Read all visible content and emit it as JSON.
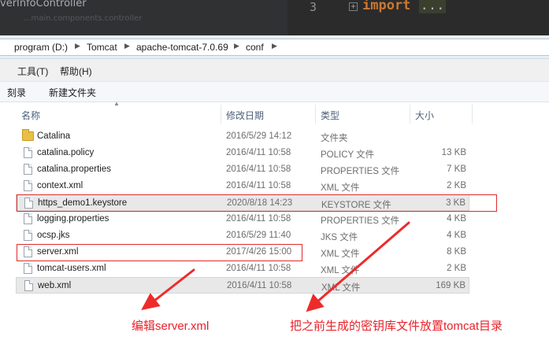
{
  "ide": {
    "class_name": "verInfoController",
    "class_name_ghost": "...main.components.controller",
    "line_number": "3",
    "fold_icon": "plus",
    "code_keyword": "import",
    "code_rest": "..."
  },
  "breadcrumbs": [
    "program (D:)",
    "Tomcat",
    "apache-tomcat-7.0.69",
    "conf"
  ],
  "menu": [
    "工具(T)",
    "帮助(H)"
  ],
  "toolbar": [
    "刻录",
    "新建文件夹"
  ],
  "columns": {
    "name": "名称",
    "date": "修改日期",
    "type": "类型",
    "size": "大小"
  },
  "files": [
    {
      "name": "Catalina",
      "date": "2016/5/29 14:12",
      "type": "文件夹",
      "size": "",
      "icon": "folder-icon"
    },
    {
      "name": "catalina.policy",
      "date": "2016/4/11 10:58",
      "type": "POLICY 文件",
      "size": "13 KB",
      "icon": "file-icon"
    },
    {
      "name": "catalina.properties",
      "date": "2016/4/11 10:58",
      "type": "PROPERTIES 文件",
      "size": "7 KB",
      "icon": "file-icon"
    },
    {
      "name": "context.xml",
      "date": "2016/4/11 10:58",
      "type": "XML 文件",
      "size": "2 KB",
      "icon": "file-icon"
    },
    {
      "name": "https_demo1.keystore",
      "date": "2020/8/18 14:23",
      "type": "KEYSTORE 文件",
      "size": "3 KB",
      "icon": "file-icon"
    },
    {
      "name": "logging.properties",
      "date": "2016/4/11 10:58",
      "type": "PROPERTIES 文件",
      "size": "4 KB",
      "icon": "file-icon"
    },
    {
      "name": "ocsp.jks",
      "date": "2016/5/29 11:40",
      "type": "JKS 文件",
      "size": "4 KB",
      "icon": "file-icon"
    },
    {
      "name": "server.xml",
      "date": "2017/4/26 15:00",
      "type": "XML 文件",
      "size": "8 KB",
      "icon": "file-icon"
    },
    {
      "name": "tomcat-users.xml",
      "date": "2016/4/11 10:58",
      "type": "XML 文件",
      "size": "2 KB",
      "icon": "file-icon"
    },
    {
      "name": "web.xml",
      "date": "2016/4/11 10:58",
      "type": "XML 文件",
      "size": "169 KB",
      "icon": "file-icon"
    }
  ],
  "annotations": {
    "edit_caption": "编辑server.xml",
    "keystore_caption": "把之前生成的密钥库文件放置tomcat目录",
    "color": "#e8222a"
  }
}
